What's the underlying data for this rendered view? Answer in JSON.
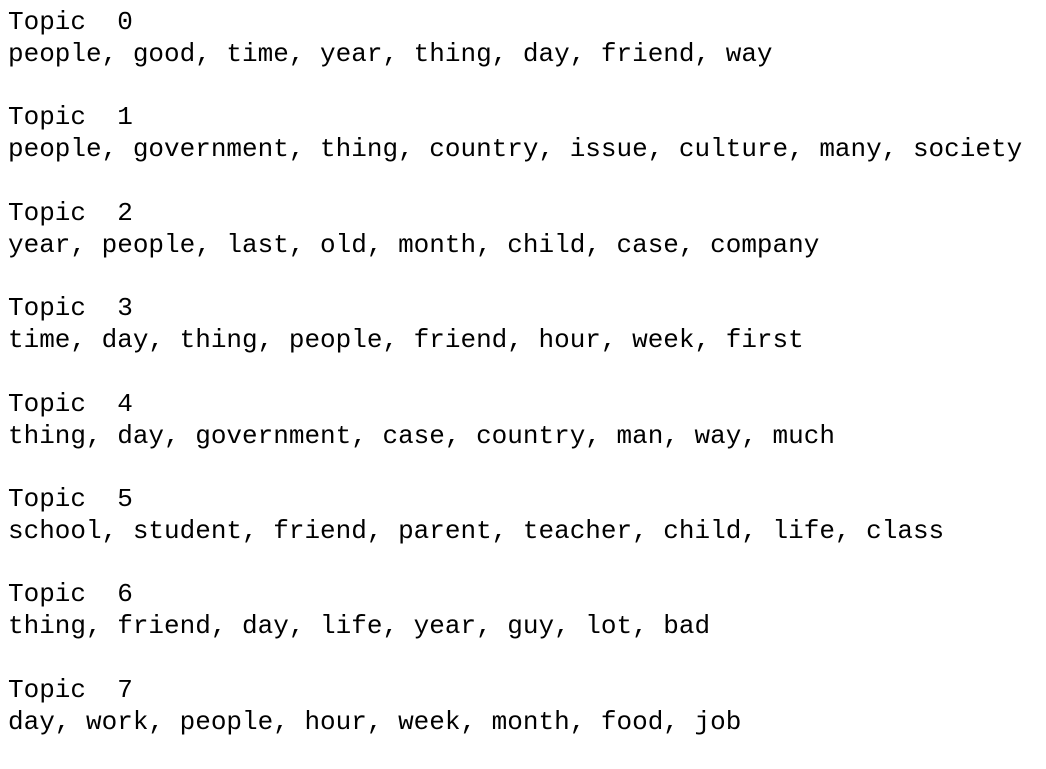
{
  "topics": [
    {
      "header": "Topic  0",
      "words": "people, good, time, year, thing, day, friend, way"
    },
    {
      "header": "Topic  1",
      "words": "people, government, thing, country, issue, culture, many, society"
    },
    {
      "header": "Topic  2",
      "words": "year, people, last, old, month, child, case, company"
    },
    {
      "header": "Topic  3",
      "words": "time, day, thing, people, friend, hour, week, first"
    },
    {
      "header": "Topic  4",
      "words": "thing, day, government, case, country, man, way, much"
    },
    {
      "header": "Topic  5",
      "words": "school, student, friend, parent, teacher, child, life, class"
    },
    {
      "header": "Topic  6",
      "words": "thing, friend, day, life, year, guy, lot, bad"
    },
    {
      "header": "Topic  7",
      "words": "day, work, people, hour, week, month, food, job"
    }
  ]
}
